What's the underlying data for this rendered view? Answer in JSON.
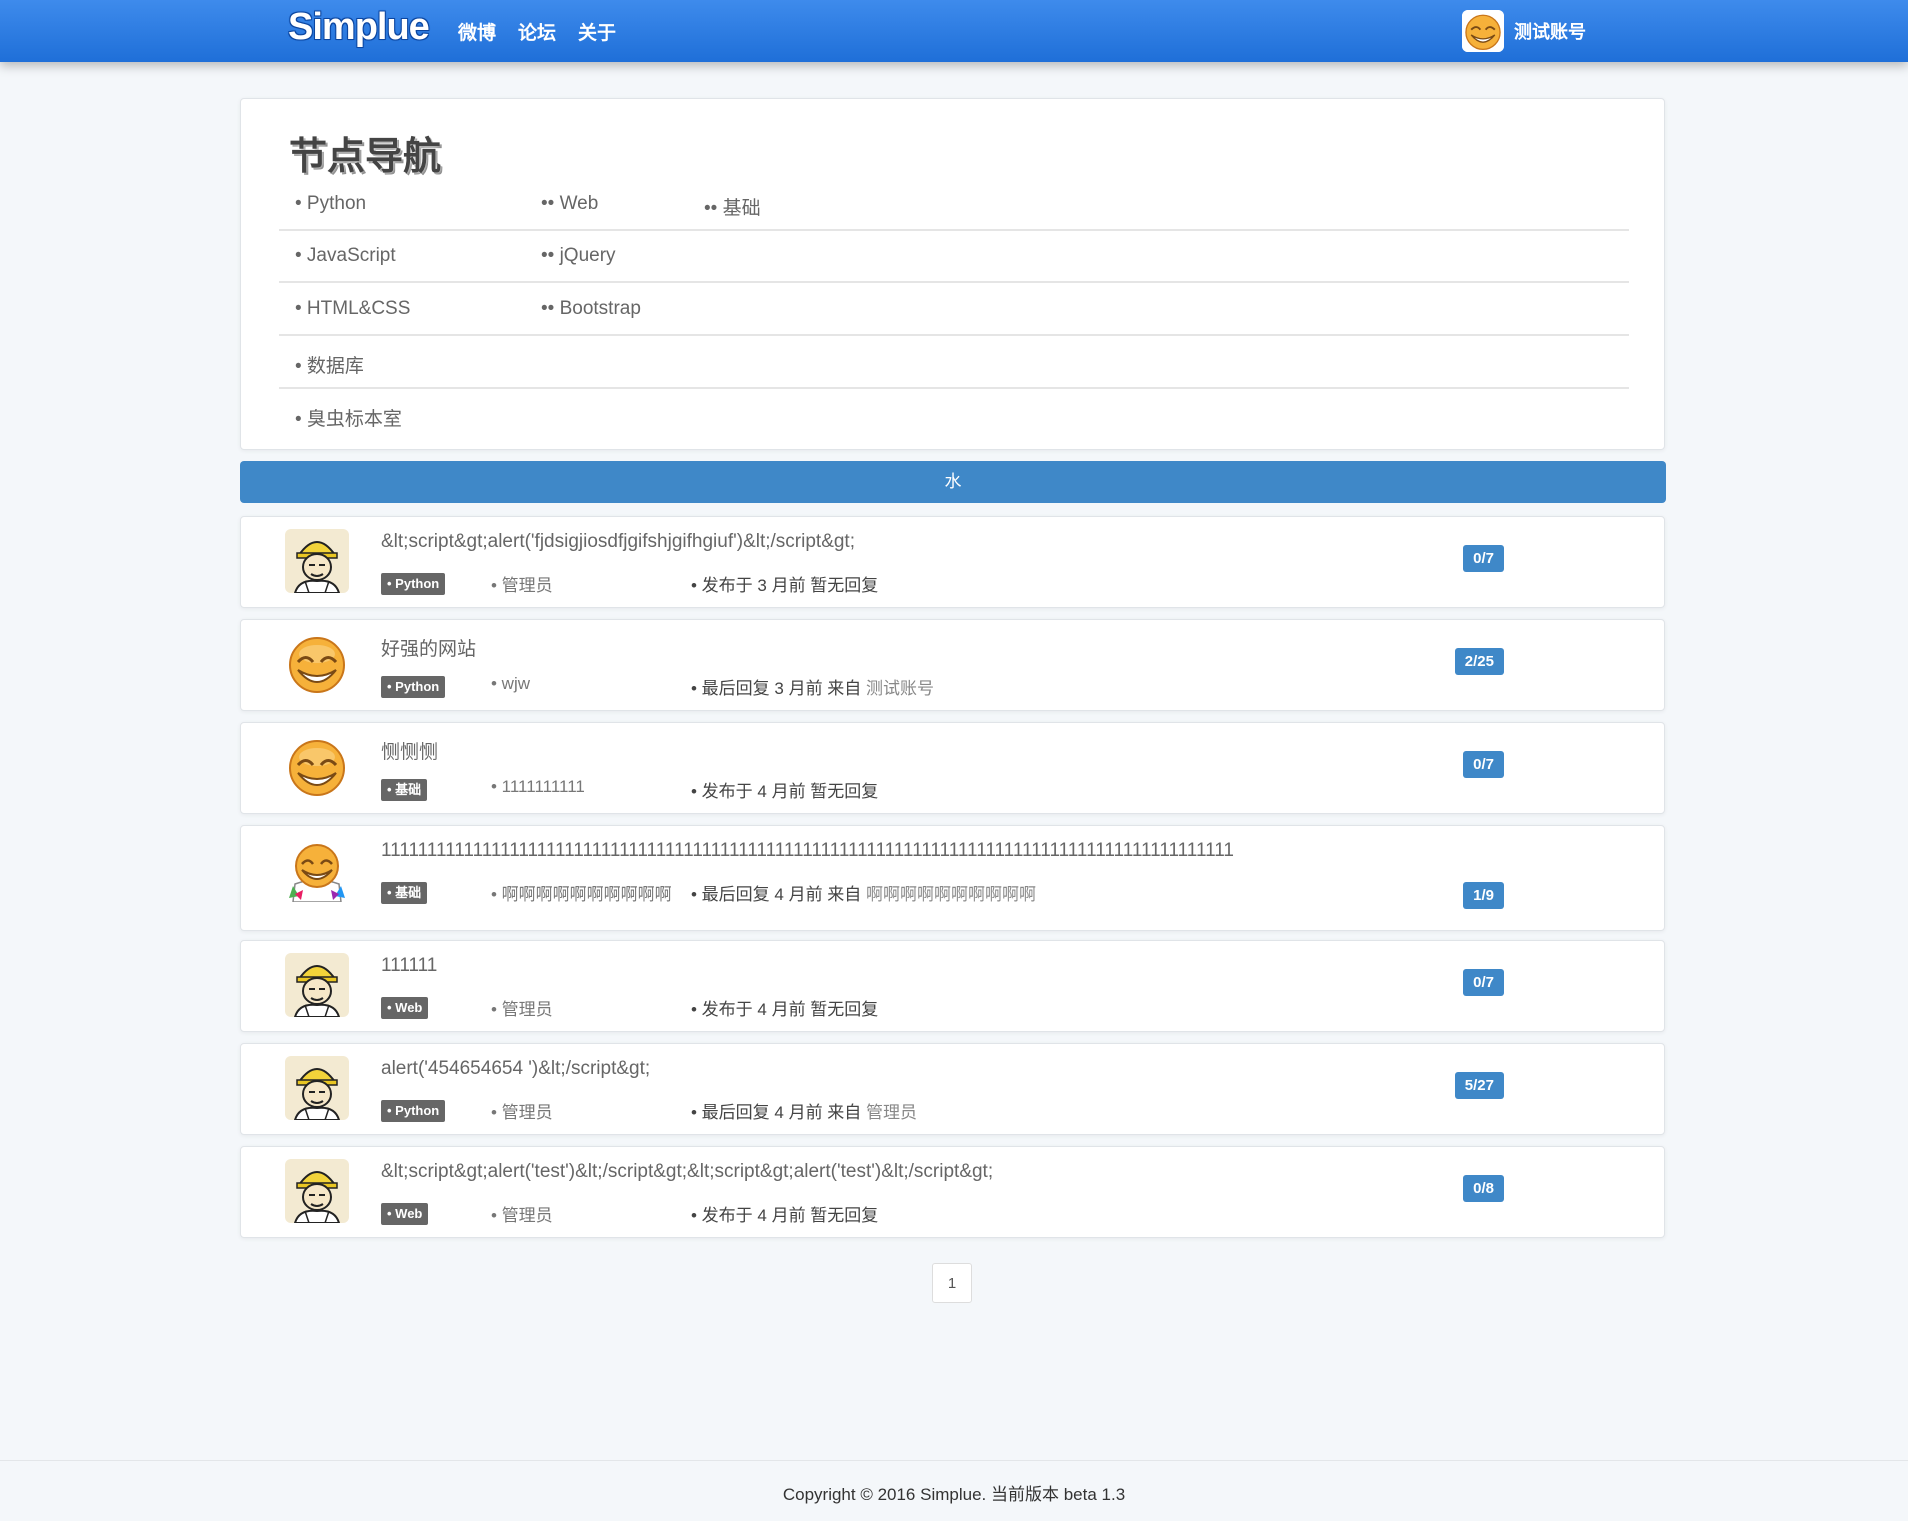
{
  "navbar": {
    "logo": "Simplue",
    "links": [
      "微博",
      "论坛",
      "关于"
    ],
    "user_name": "测试账号"
  },
  "nodes": {
    "title": "节点导航",
    "rows": [
      [
        "• Python",
        "•• Web",
        "•• 基础"
      ],
      [
        "• JavaScript",
        "•• jQuery"
      ],
      [
        "• HTML&CSS",
        "•• Bootstrap"
      ],
      [
        "• 数据库"
      ],
      [
        "• 臭虫标本室"
      ]
    ]
  },
  "section": {
    "title": "水"
  },
  "topics": [
    {
      "title": "&lt;script&gt;alert('fjdsigjiosdfjgifshjgifhgiuf')&lt;/script&gt;",
      "tag": "• Python",
      "author": "• 管理员",
      "meta_prefix": "• 发布于  3 月前   暂无回复",
      "meta_who": "",
      "badge": "0/7",
      "avatar": "worker"
    },
    {
      "title": "好强的网站",
      "tag": "• Python",
      "author": "• wjw",
      "meta_prefix": "• 最后回复 3 月前  来自 ",
      "meta_who": "测试账号",
      "badge": "2/25",
      "avatar": "smiley"
    },
    {
      "title": "恻恻恻",
      "tag": "• 基础",
      "author": "• 1111111111",
      "meta_prefix": "• 发布于  4 月前   暂无回复",
      "meta_who": "",
      "badge": "0/7",
      "avatar": "smiley"
    },
    {
      "title": "111111111111111111111111111111111111111111111111111111111111111111111111111111111111111111111",
      "tag": "• 基础",
      "author": "• 啊啊啊啊啊啊啊啊啊啊",
      "meta_prefix": "• 最后回复 4 月前  来自 ",
      "meta_who": "啊啊啊啊啊啊啊啊啊啊",
      "badge": "1/9",
      "avatar": "smiley2"
    },
    {
      "title": "111111",
      "tag": "• Web",
      "author": "• 管理员",
      "meta_prefix": "• 发布于  4 月前   暂无回复",
      "meta_who": "",
      "badge": "0/7",
      "avatar": "worker"
    },
    {
      "title": "alert('454654654 ')&lt;/script&gt;",
      "tag": "• Python",
      "author": "• 管理员",
      "meta_prefix": "• 最后回复 4 月前  来自 ",
      "meta_who": "管理员",
      "badge": "5/27",
      "avatar": "worker"
    },
    {
      "title": "&lt;script&gt;alert('test')&lt;/script&gt;&lt;script&gt;alert('test')&lt;/script&gt;",
      "tag": "• Web",
      "author": "• 管理员",
      "meta_prefix": "• 发布于  4 月前   暂无回复",
      "meta_who": "",
      "badge": "0/8",
      "avatar": "worker"
    }
  ],
  "pagination": {
    "current": "1"
  },
  "footer": {
    "text": "Copyright © 2016 Simplue. 当前版本 beta 1.3"
  }
}
